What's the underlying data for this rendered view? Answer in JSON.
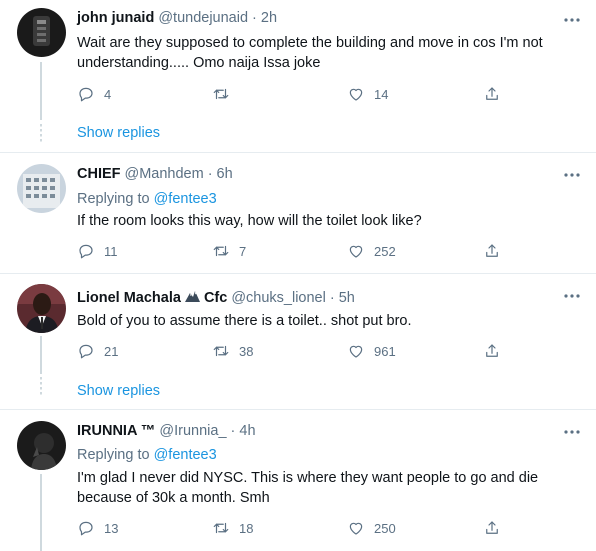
{
  "tweets": [
    {
      "name": "john junaid",
      "handle": "@tundejunaid",
      "sep": "·",
      "time": "2h",
      "replying_prefix": "",
      "replying_to": "",
      "text": "Wait are they supposed to complete the building and move in cos I'm not understanding..... Omo naija Issa joke",
      "reply_count": "4",
      "retweet_count": "",
      "like_count": "14",
      "show_replies": "Show replies"
    },
    {
      "name": "CHIEF",
      "handle": "@Manhdem",
      "sep": "·",
      "time": "6h",
      "replying_prefix": "Replying to",
      "replying_to": "@fentee3",
      "text": "If the room looks this way, how will the toilet look like?",
      "reply_count": "11",
      "retweet_count": "7",
      "like_count": "252",
      "show_replies": ""
    },
    {
      "name": "Lionel Machala",
      "name_suffix": "Cfc",
      "handle": "@chuks_lionel",
      "sep": "·",
      "time": "5h",
      "replying_prefix": "",
      "replying_to": "",
      "text": "Bold of you to assume there is a toilet.. shot put bro.",
      "reply_count": "21",
      "retweet_count": "38",
      "like_count": "961",
      "show_replies": "Show replies"
    },
    {
      "name": "IRUNNIA ™",
      "handle": "@Irunnia_",
      "sep": "·",
      "time": "4h",
      "replying_prefix": "Replying to",
      "replying_to": "@fentee3",
      "text": "I'm glad I never did NYSC. This is where they want people to go and die because of 30k a month. Smh",
      "reply_count": "13",
      "retweet_count": "18",
      "like_count": "250",
      "show_replies": ""
    }
  ],
  "icons": {
    "reply": "reply-icon",
    "retweet": "retweet-icon",
    "like": "heart-icon",
    "share": "share-icon",
    "more": "more-icon"
  },
  "colors": {
    "link": "#1b95e0",
    "secondary_text": "#5b7083",
    "divider": "#e6ecf0"
  }
}
